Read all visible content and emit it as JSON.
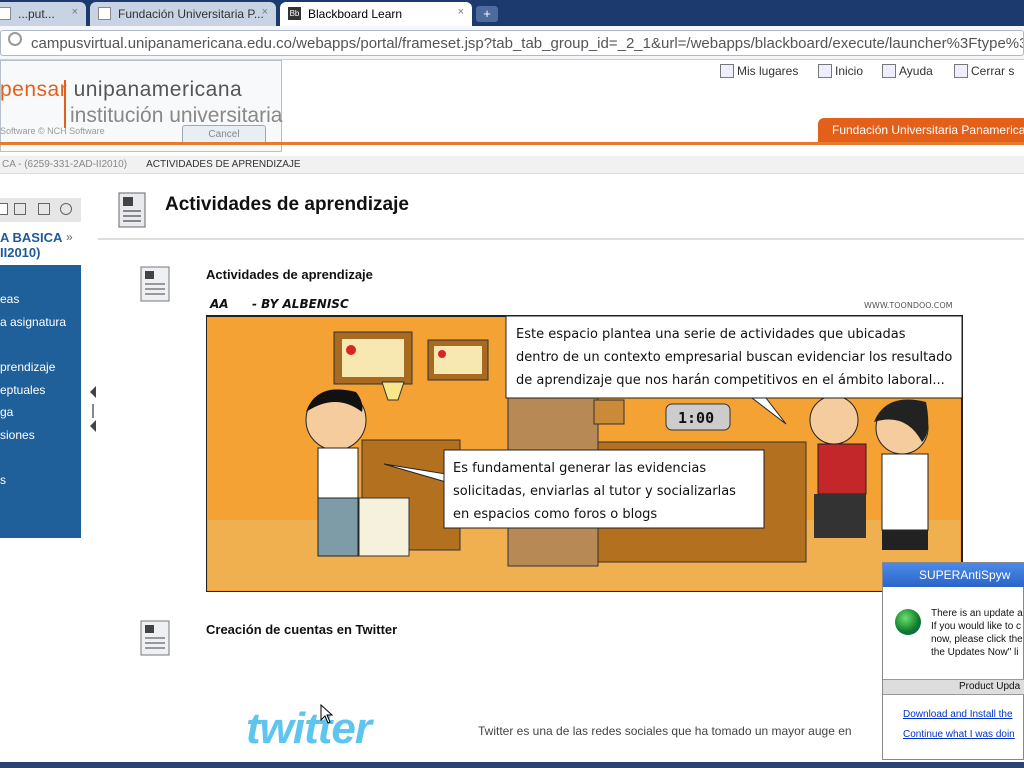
{
  "browser": {
    "tabs": [
      {
        "label": "...put...",
        "active": false,
        "icon": "page-icon"
      },
      {
        "label": "Fundación Universitaria P...",
        "active": false,
        "icon": "page-icon"
      },
      {
        "label": "Blackboard Learn",
        "active": true,
        "icon": "blackboard-icon"
      }
    ],
    "new_tab": "+",
    "close_glyph": "×",
    "url": "campusvirtual.unipanamericana.edu.co/webapps/portal/frameset.jsp?tab_tab_group_id=_2_1&url=/webapps/blackboard/execute/launcher%3Ftype%3D"
  },
  "header": {
    "toplinks": [
      {
        "label": "Mis lugares",
        "icon": "person-icon"
      },
      {
        "label": "Inicio",
        "icon": "home-icon"
      },
      {
        "label": "Ayuda",
        "icon": "help-icon"
      },
      {
        "label": "Cerrar s",
        "icon": "logout-icon"
      }
    ],
    "logo_line1_a": "pensar",
    "logo_line1_b": "unipanamericana",
    "logo_line2": "institución universitaria",
    "nch_text": "Software © NCH Software",
    "cancel_label": "Cancel",
    "institution_button": "Fundación Universitaria Panamericana",
    "accent_color": "#e2601a"
  },
  "breadcrumb": {
    "course": "CA - (6259-331-2AD-II2010)",
    "current": "ACTIVIDADES DE APRENDIZAJE"
  },
  "sidebar": {
    "title_line1": "A BASICA",
    "title_line2": "II2010)",
    "chevron": "»",
    "nav_items": [
      "eas",
      "a asignatura",
      "prendizaje",
      "eptuales",
      "ga",
      "siones",
      "s"
    ]
  },
  "main": {
    "page_title": "Actividades de aprendizaje",
    "items": [
      {
        "title": "Actividades de aprendizaje"
      },
      {
        "title": "Creación de cuentas en Twitter"
      }
    ],
    "comic": {
      "title_left": "AA",
      "title_right": "- BY ALBENISC",
      "watermark": "WWW.TOONDOO.COM",
      "clock": "1:00",
      "bubble1": [
        "Este espacio plantea una serie de actividades que ubicadas",
        "dentro de un contexto empresarial buscan evidenciar los resultado",
        "de aprendizaje que nos harán competitivos en el ámbito laboral..."
      ],
      "bubble2": [
        "Es fundamental generar las evidencias",
        "solicitadas, enviarlas al tutor y socializarlas",
        "en espacios como foros o blogs"
      ]
    },
    "twitter_logo": "twitter",
    "twitter_text": "Twitter es una de las redes sociales que ha tomado un mayor auge en"
  },
  "popup": {
    "title": "SUPERAntiSpyw",
    "text_lines": [
      "There is an update a",
      "If you would like to c",
      "now, please click the",
      "the Updates Now\" li"
    ],
    "section": "Product Upda",
    "links": [
      "Download and Install the",
      "Continue what I was doin"
    ]
  }
}
